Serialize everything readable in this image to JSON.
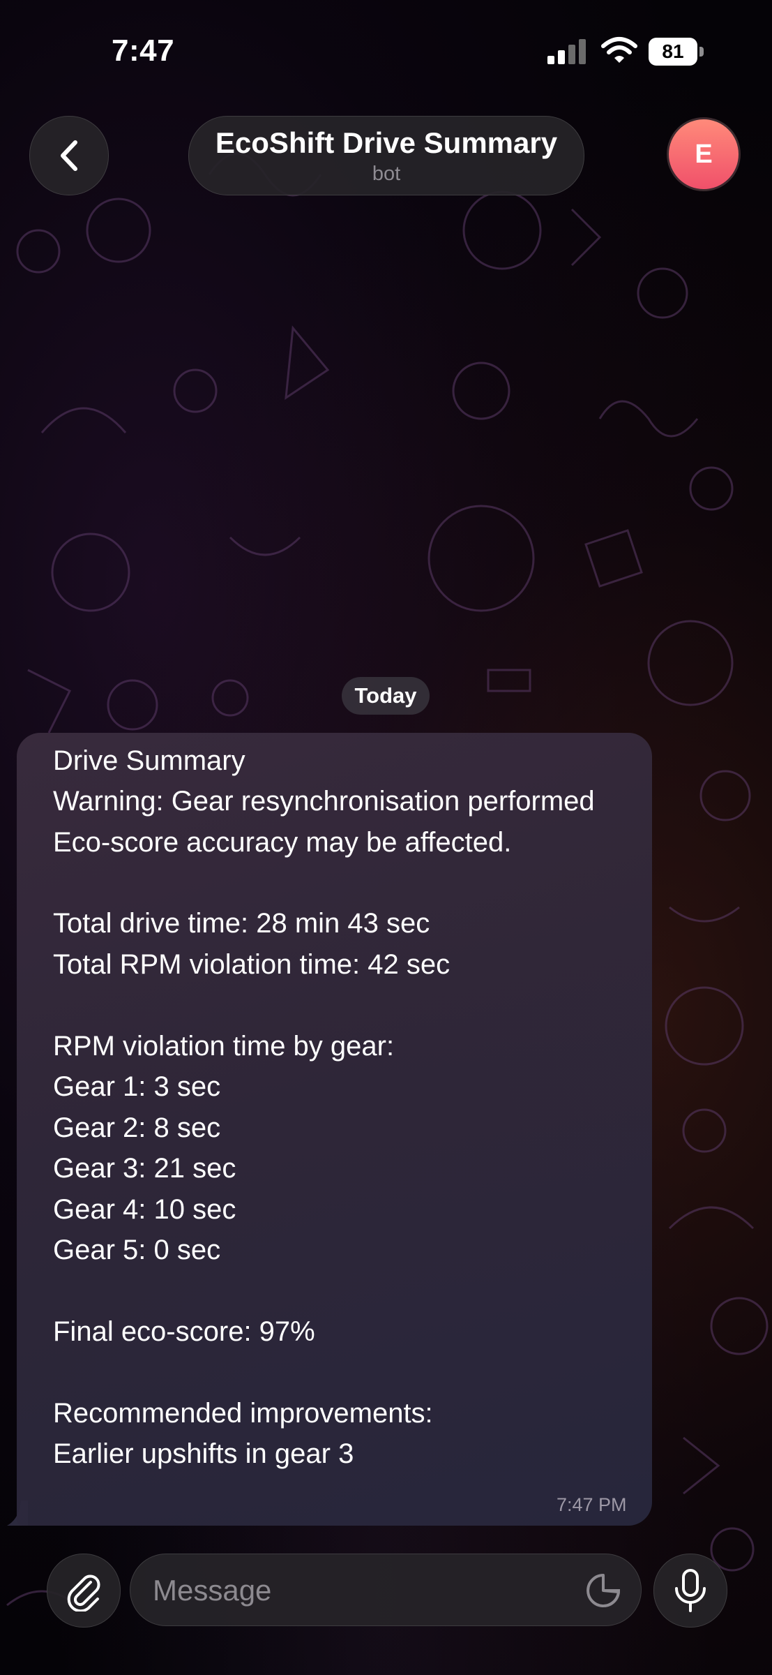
{
  "status_bar": {
    "time": "7:47",
    "battery_level": "81",
    "signal_icon": "cellular-signal-icon",
    "wifi_icon": "wifi-icon"
  },
  "header": {
    "back_icon": "chevron-left-icon",
    "title": "EcoShift Drive Summary",
    "subtitle": "bot",
    "avatar_initial": "E",
    "avatar_color": "#f0506a"
  },
  "chat": {
    "date_label": "Today",
    "message": {
      "lines": {
        "l0": "Drive Summary",
        "l1": "Warning: Gear resynchronisation performed",
        "l2": "Eco-score accuracy may be affected.",
        "l3": "Total drive time: 28 min 43 sec",
        "l4": "Total RPM violation time: 42 sec",
        "l5": "RPM violation time by gear:",
        "l6": "Gear 1: 3 sec",
        "l7": "Gear 2: 8 sec",
        "l8": "Gear 3: 21 sec",
        "l9": "Gear 4: 10 sec",
        "l10": "Gear 5: 0 sec",
        "l11": "Final eco-score: 97%",
        "l12": "Recommended improvements:",
        "l13": "Earlier upshifts in gear 3"
      },
      "time": "7:47 PM"
    }
  },
  "input_bar": {
    "attach_icon": "paperclip-icon",
    "placeholder": "Message",
    "sticker_icon": "sticker-icon",
    "mic_icon": "microphone-icon"
  }
}
